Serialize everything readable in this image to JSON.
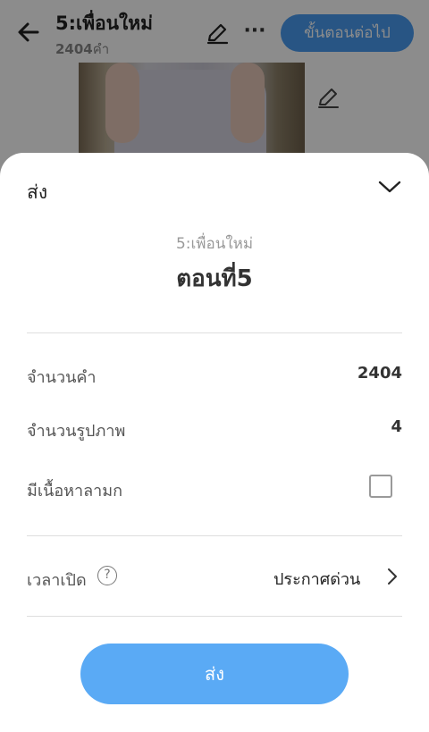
{
  "header": {
    "title": "5:เพื่อนใหม่",
    "word_count": "2404",
    "word_unit": "คำ",
    "next_label": "ขั้นตอนต่อไป",
    "more_label": "···"
  },
  "sheet": {
    "title": "ส่ง",
    "story_name": "5:เพื่อนใหม่",
    "episode_name": "ตอนที่5",
    "rows": {
      "word_count_label": "จำนวนคำ",
      "word_count_value": "2404",
      "image_count_label": "จำนวนรูปภาพ",
      "image_count_value": "4",
      "mature_label": "มีเนื้อหาลามก",
      "publish_time_label": "เวลาเปิด",
      "publish_time_value": "ประกาศด่วน",
      "help_symbol": "?"
    },
    "send_label": "ส่ง"
  },
  "colors": {
    "accent": "#5aaaf5",
    "overlay": "rgba(0,0,0,0.45)"
  }
}
